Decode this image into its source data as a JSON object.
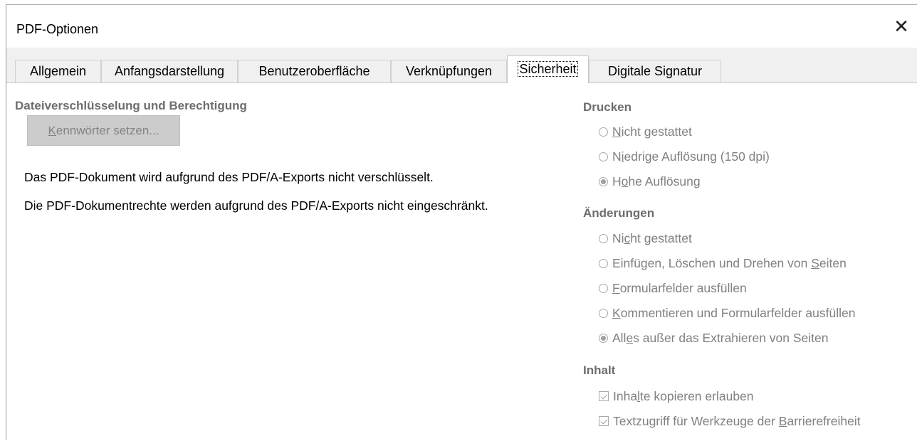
{
  "window": {
    "title": "PDF-Optionen",
    "close_glyph": "✕"
  },
  "tabs": [
    {
      "label": "Allgemein"
    },
    {
      "label": "Anfangsdarstellung"
    },
    {
      "label": "Benutzeroberfläche"
    },
    {
      "label": "Verknüpfungen"
    },
    {
      "label": "Sicherheit",
      "active": true
    },
    {
      "label": "Digitale Signatur"
    }
  ],
  "left": {
    "header": "Dateiverschlüsselung und Berechtigung",
    "set_passwords_button": {
      "label_underlined": "K",
      "label_rest": "ennwörter setzen..."
    },
    "info_encrypt": "Das PDF-Dokument wird aufgrund des PDF/A-Exports nicht verschlüsselt.",
    "info_rights": "Die PDF-Dokumentrechte werden aufgrund des PDF/A-Exports nicht eingeschränkt."
  },
  "printing": {
    "header": "Drucken",
    "options": [
      {
        "pre": "",
        "u": "N",
        "post": "icht gestattet",
        "selected": false
      },
      {
        "pre": "N",
        "u": "i",
        "post": "edrige Auflösung (150 dpi)",
        "selected": false
      },
      {
        "pre": "H",
        "u": "o",
        "post": "he Auflösung",
        "selected": true
      }
    ]
  },
  "changes": {
    "header": "Änderungen",
    "options": [
      {
        "pre": "Ni",
        "u": "c",
        "post": "ht gestattet",
        "selected": false
      },
      {
        "pre": "Einfügen, Löschen und Drehen von ",
        "u": "S",
        "post": "eiten",
        "selected": false
      },
      {
        "pre": "",
        "u": "F",
        "post": "ormularfelder ausfüllen",
        "selected": false
      },
      {
        "pre": "",
        "u": "K",
        "post": "ommentieren und Formularfelder ausfüllen",
        "selected": false
      },
      {
        "pre": "All",
        "u": "e",
        "post": "s außer das Extrahieren von Seiten",
        "selected": true
      }
    ]
  },
  "content": {
    "header": "Inhalt",
    "options": [
      {
        "pre": "Inha",
        "u": "l",
        "post": "te kopieren erlauben",
        "checked": true
      },
      {
        "pre": "Textzugriff für Werkzeuge der ",
        "u": "B",
        "post": "arrierefreiheit",
        "checked": true
      }
    ]
  },
  "colors": {
    "disabled_text": "#808080",
    "header_text": "#6d6d6d",
    "button_bg": "#cccccc"
  }
}
